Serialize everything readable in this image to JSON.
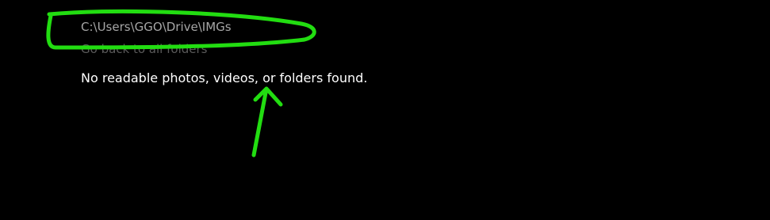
{
  "folder": {
    "path": "C:\\Users\\GGO\\Drive\\IMGs",
    "back_link": "Go back to all folders"
  },
  "message": {
    "empty_state": "No readable photos, videos, or folders found."
  },
  "annotation": {
    "color": "#22dd11"
  }
}
